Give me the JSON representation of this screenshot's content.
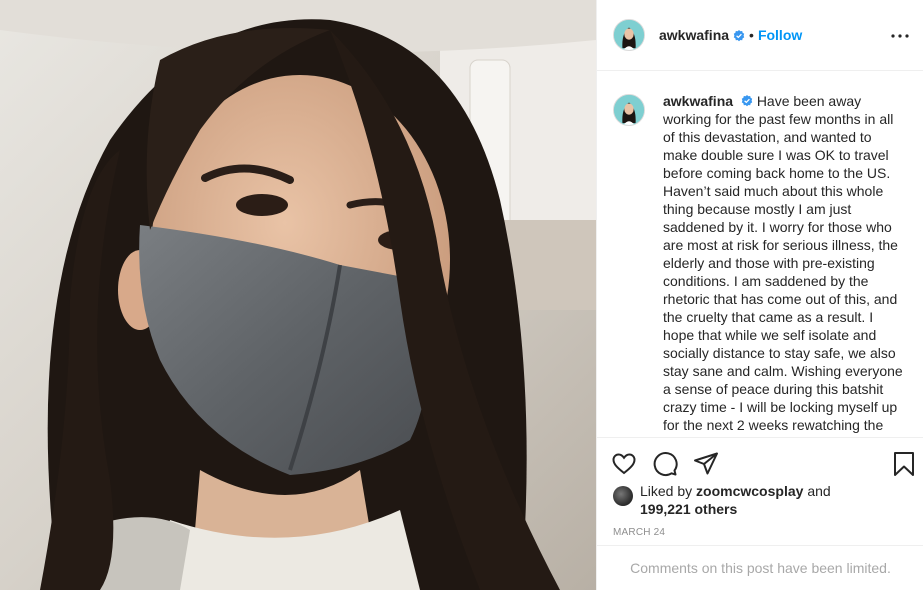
{
  "post": {
    "username": "awkwafina",
    "follow_label": "Follow",
    "separator": "•",
    "caption_user": "awkwafina",
    "caption": "Have been away working for the past few months in all of this devastation, and wanted to make double sure I was OK to travel before coming back home to the US. Haven’t said much about this whole thing because mostly I am just saddened by it. I worry for those who are most at risk for serious illness, the elderly and those with pre-existing conditions. I am saddened by the rhetoric that has come out of this, and the cruelty that came as a result. I hope that while we self isolate and socially distance to stay safe, we also stay sane and calm. Wishing everyone a sense of peace during this batshit crazy time - I will be locking myself up for the next 2 weeks rewatching the",
    "liked_by_prefix": "Liked by",
    "liked_by_user": "zoomcwcosplay",
    "liked_by_and": "and",
    "likes_count": "199,221 others",
    "date": "MARCH 24",
    "comments_notice": "Comments on this post have been limited."
  },
  "colors": {
    "accent": "#0095f6",
    "verified": "#3897f0",
    "muted": "#8e8e8e",
    "divider": "#efefef"
  },
  "icons": {
    "verified": "verified-badge-icon",
    "more": "more-options-icon",
    "like": "heart-icon",
    "comment": "comment-bubble-icon",
    "share": "paper-plane-icon",
    "save": "bookmark-icon"
  }
}
